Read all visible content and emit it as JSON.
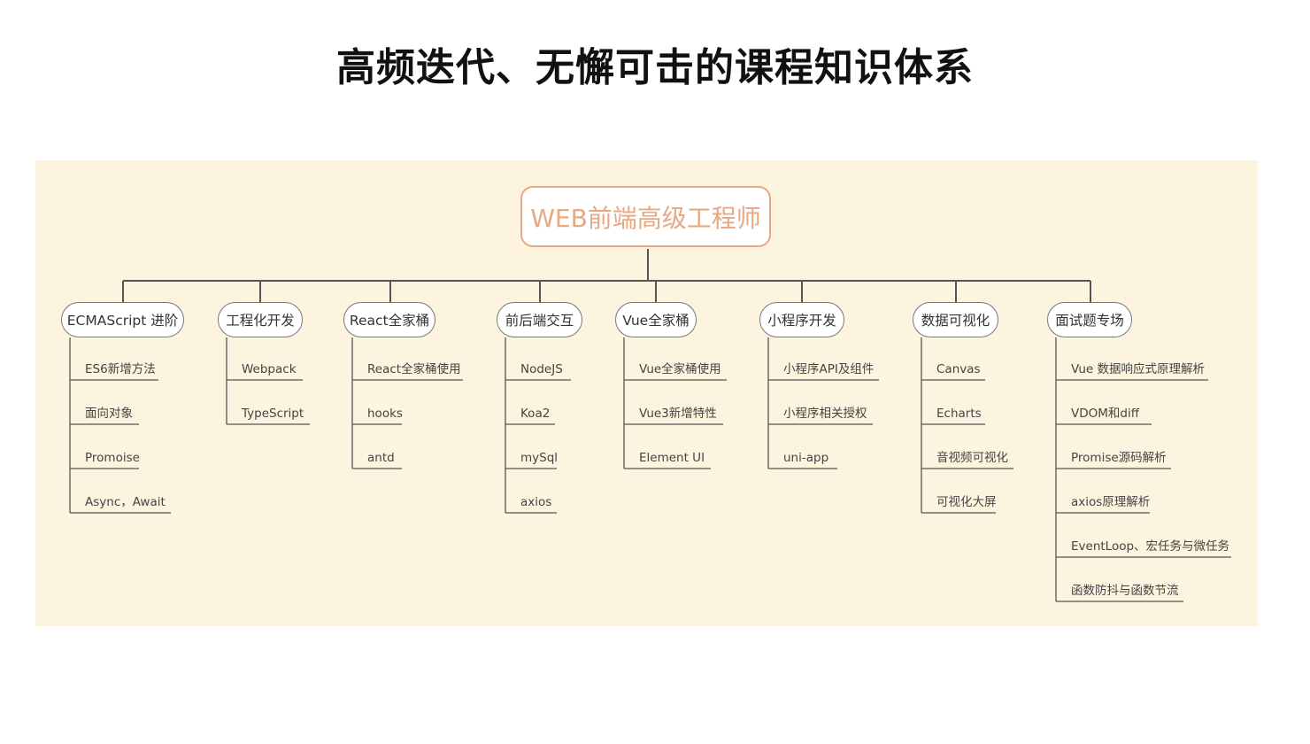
{
  "title": "高频迭代、无懈可击的课程知识体系",
  "colors": {
    "background_panel": "#fcf4df",
    "root_border": "#e8a882",
    "root_text": "#e8a882",
    "connector": "#555555"
  },
  "root": {
    "label": "WEB前端高级工程师"
  },
  "branches": [
    {
      "label": "ECMAScript 进阶",
      "children": [
        "ES6新增方法",
        "面向对象",
        "Promoise",
        "Async，Await"
      ]
    },
    {
      "label": "工程化开发",
      "children": [
        "Webpack",
        "TypeScript"
      ]
    },
    {
      "label": "React全家桶",
      "children": [
        "React全家桶使用",
        "hooks",
        "antd"
      ]
    },
    {
      "label": "前后端交互",
      "children": [
        "NodeJS",
        "Koa2",
        "mySql",
        "axios"
      ]
    },
    {
      "label": "Vue全家桶",
      "children": [
        "Vue全家桶使用",
        "Vue3新增特性",
        "Element UI"
      ]
    },
    {
      "label": "小程序开发",
      "children": [
        "小程序API及组件",
        "小程序相关授权",
        "uni-app"
      ]
    },
    {
      "label": "数据可视化",
      "children": [
        "Canvas",
        "Echarts",
        "音视频可视化",
        "可视化大屏"
      ]
    },
    {
      "label": "面试题专场",
      "children": [
        "Vue 数据响应式原理解析",
        "VDOM和diff",
        "Promise源码解析",
        "axios原理解析",
        "EventLoop、宏任务与微任务",
        "函数防抖与函数节流"
      ]
    }
  ]
}
